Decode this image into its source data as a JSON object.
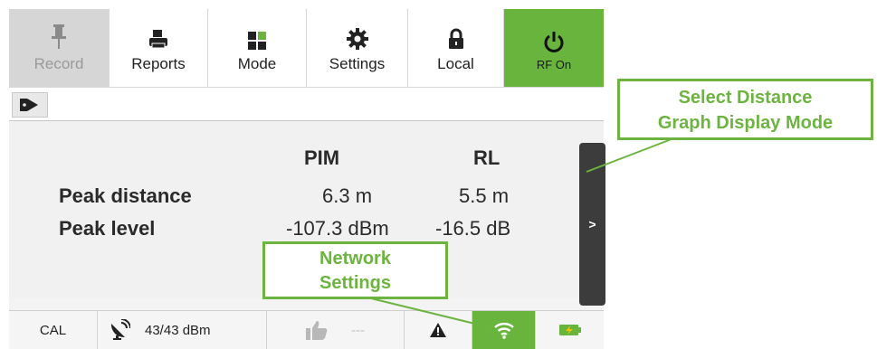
{
  "toolbar": {
    "record_label": "Record",
    "reports_label": "Reports",
    "mode_label": "Mode",
    "settings_label": "Settings",
    "local_label": "Local",
    "rf_label": "RF On",
    "rf_color": "#68b43c"
  },
  "results": {
    "col_pim": "PIM",
    "col_rl": "RL",
    "row1_label": "Peak distance",
    "row1_pim": "6.3 m",
    "row1_rl": "5.5 m",
    "row2_label": "Peak level",
    "row2_pim": "-107.3 dBm",
    "row2_rl": "-16.5 dB",
    "side_arrow": ">"
  },
  "status": {
    "cal": "CAL",
    "power": "43/43 dBm",
    "dashes": "---"
  },
  "callouts": {
    "distance_line1": "Select Distance",
    "distance_line2": "Graph Display Mode",
    "network_line1": "Network",
    "network_line2": "Settings"
  },
  "colors": {
    "accent": "#6cb43f",
    "dark_button": "#3c3c3c"
  }
}
